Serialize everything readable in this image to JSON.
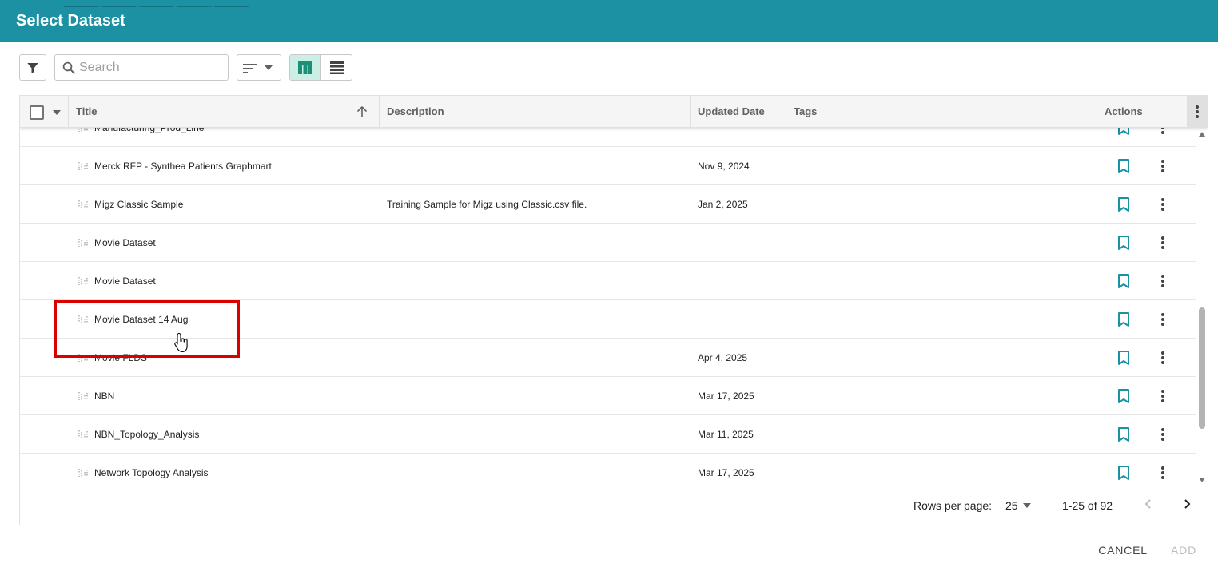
{
  "dialog": {
    "title": "Select Dataset",
    "peek_text": "______ ______ ______ ______ ______"
  },
  "toolbar": {
    "search_placeholder": "Search"
  },
  "table": {
    "columns": {
      "title": "Title",
      "description": "Description",
      "updated": "Updated Date",
      "tags": "Tags",
      "actions": "Actions"
    },
    "rows": [
      {
        "title": "Manufacturing_Prod_Line",
        "description": "",
        "updated": ""
      },
      {
        "title": "Merck RFP - Synthea Patients Graphmart",
        "description": "",
        "updated": "Nov 9, 2024"
      },
      {
        "title": "Migz Classic Sample",
        "description": "Training Sample for Migz using Classic.csv file.",
        "updated": "Jan 2, 2025"
      },
      {
        "title": "Movie Dataset",
        "description": "",
        "updated": ""
      },
      {
        "title": "Movie Dataset",
        "description": "",
        "updated": ""
      },
      {
        "title": "Movie Dataset 14 Aug",
        "description": "",
        "updated": ""
      },
      {
        "title": "Movie FLDS",
        "description": "",
        "updated": "Apr 4, 2025"
      },
      {
        "title": "NBN",
        "description": "",
        "updated": "Mar 17, 2025"
      },
      {
        "title": "NBN_Topology_Analysis",
        "description": "",
        "updated": "Mar 11, 2025"
      },
      {
        "title": "Network Topology Analysis",
        "description": "",
        "updated": "Mar 17, 2025"
      }
    ]
  },
  "pager": {
    "rows_per_page_label": "Rows per page:",
    "rows_per_page_value": "25",
    "range_text": "1-25 of 92"
  },
  "footer": {
    "cancel_label": "CANCEL",
    "add_label": "ADD"
  },
  "colors": {
    "header": "#1b91a3",
    "accent": "#1b91a3",
    "highlight": "#d90000"
  }
}
